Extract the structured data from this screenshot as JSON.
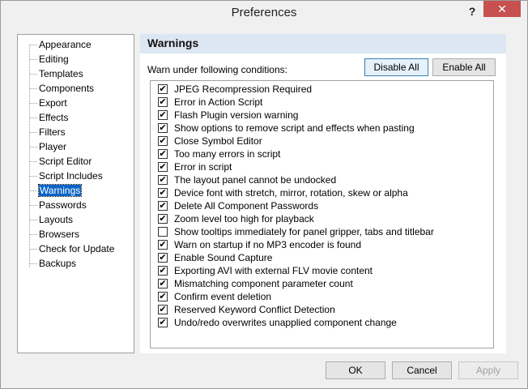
{
  "window": {
    "title": "Preferences",
    "help_glyph": "?",
    "close_glyph": "✕"
  },
  "sidebar": {
    "items": [
      {
        "label": "Appearance",
        "selected": false
      },
      {
        "label": "Editing",
        "selected": false
      },
      {
        "label": "Templates",
        "selected": false
      },
      {
        "label": "Components",
        "selected": false
      },
      {
        "label": "Export",
        "selected": false
      },
      {
        "label": "Effects",
        "selected": false
      },
      {
        "label": "Filters",
        "selected": false
      },
      {
        "label": "Player",
        "selected": false
      },
      {
        "label": "Script Editor",
        "selected": false
      },
      {
        "label": "Script Includes",
        "selected": false
      },
      {
        "label": "Warnings",
        "selected": true
      },
      {
        "label": "Passwords",
        "selected": false
      },
      {
        "label": "Layouts",
        "selected": false
      },
      {
        "label": "Browsers",
        "selected": false
      },
      {
        "label": "Check for Update",
        "selected": false
      },
      {
        "label": "Backups",
        "selected": false
      }
    ]
  },
  "panel": {
    "header": "Warnings",
    "conditions_label": "Warn under following conditions:",
    "disable_all": "Disable All",
    "enable_all": "Enable All",
    "warnings": [
      {
        "label": "JPEG Recompression Required",
        "checked": true
      },
      {
        "label": "Error in Action Script",
        "checked": true
      },
      {
        "label": "Flash Plugin version warning",
        "checked": true
      },
      {
        "label": "Show options to remove script and effects when pasting",
        "checked": true
      },
      {
        "label": "Close Symbol Editor",
        "checked": true
      },
      {
        "label": "Too many errors in script",
        "checked": true
      },
      {
        "label": "Error in script",
        "checked": true
      },
      {
        "label": "The layout panel cannot be undocked",
        "checked": true
      },
      {
        "label": "Device font with stretch, mirror, rotation, skew or alpha",
        "checked": true
      },
      {
        "label": "Delete All Component Passwords",
        "checked": true
      },
      {
        "label": "Zoom level too high for playback",
        "checked": true
      },
      {
        "label": "Show tooltips immediately for panel gripper, tabs and titlebar",
        "checked": false
      },
      {
        "label": "Warn on startup if no MP3 encoder is found",
        "checked": true
      },
      {
        "label": "Enable Sound Capture",
        "checked": true
      },
      {
        "label": "Exporting AVI with external FLV movie content",
        "checked": true
      },
      {
        "label": "Mismatching component parameter count",
        "checked": true
      },
      {
        "label": "Confirm event deletion",
        "checked": true
      },
      {
        "label": "Reserved Keyword Conflict Detection",
        "checked": true
      },
      {
        "label": "Undo/redo overwrites unapplied component change",
        "checked": true
      }
    ]
  },
  "footer": {
    "ok": "OK",
    "cancel": "Cancel",
    "apply": "Apply"
  }
}
